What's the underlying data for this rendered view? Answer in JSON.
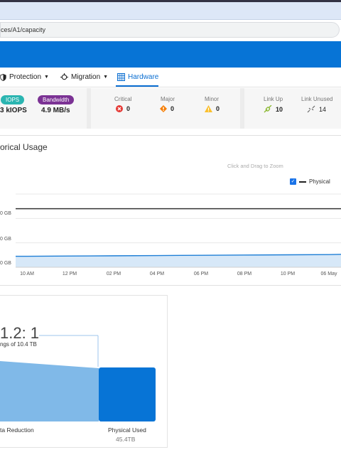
{
  "browser": {
    "url": "ces/A1/capacity"
  },
  "nav": {
    "items": [
      {
        "label": "Protection",
        "icon": "shield-icon"
      },
      {
        "label": "Migration",
        "icon": "migration-icon"
      },
      {
        "label": "Hardware",
        "icon": "hardware-grid-icon"
      }
    ]
  },
  "stats": {
    "iops": {
      "badge": "IOPS",
      "value": "3 kIOPS",
      "color": "#2bb5b1"
    },
    "bandwidth": {
      "badge": "Bandwidth",
      "value": "4.9 MB/s",
      "color": "#7b3294"
    },
    "alerts": {
      "critical": {
        "label": "Critical",
        "value": "0",
        "color": "#e53935"
      },
      "major": {
        "label": "Major",
        "value": "0",
        "color": "#f57c00"
      },
      "minor": {
        "label": "Minor",
        "value": "0",
        "color": "#fbc02d"
      }
    },
    "links": {
      "up": {
        "label": "Link Up",
        "value": "10",
        "color": "#8bb832"
      },
      "unused": {
        "label": "Link Unused",
        "value": "14"
      }
    }
  },
  "usage": {
    "title": "orical Usage",
    "hint": "Click and Drag to Zoom",
    "legend": "Physical"
  },
  "chart_data": {
    "type": "area",
    "title": "orical Usage",
    "x": [
      "10 AM",
      "12 PM",
      "02 PM",
      "04 PM",
      "06 PM",
      "08 PM",
      "10 PM",
      "06 May"
    ],
    "y_tick_labels": [
      "0 GB",
      "0 GB",
      "0 GB"
    ],
    "series": [
      {
        "name": "Physical",
        "values": [
          9,
          9.2,
          9.4,
          9.6,
          9.8,
          10,
          10.2,
          10.4
        ]
      }
    ],
    "reference_line": {
      "value": 48
    },
    "ylim": [
      0,
      60
    ],
    "legend_position": "top-right",
    "grid": true
  },
  "reduction": {
    "ratio": "1.2: 1",
    "savings": "ngs of 10.4 TB",
    "left_label": "ta Reduction",
    "right_label": "Physical Used",
    "right_value": "45.4TB"
  }
}
